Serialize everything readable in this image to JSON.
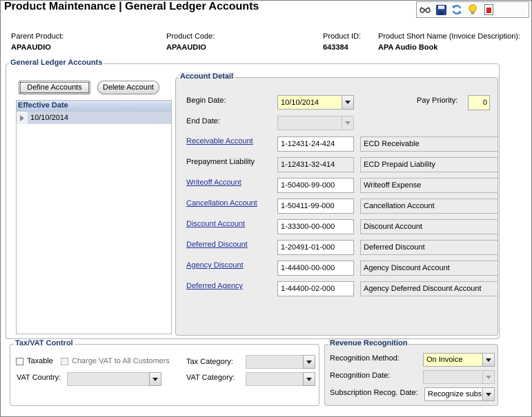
{
  "window": {
    "title": "Product Maintenance  |  General Ledger Accounts"
  },
  "toolbar": {
    "icons": [
      "glasses-icon",
      "save-icon",
      "refresh-icon",
      "lightbulb-icon",
      "report-icon"
    ]
  },
  "header": {
    "parent_product_label": "Parent Product:",
    "parent_product_value": "APAAUDIO",
    "product_code_label": "Product Code:",
    "product_code_value": "APAAUDIO",
    "product_id_label": "Product ID:",
    "product_id_value": "643384",
    "short_name_label": "Product Short Name (Invoice Description):",
    "short_name_value": "APA Audio Book"
  },
  "gl_accounts": {
    "legend": "General Ledger Accounts",
    "define_accounts_label": "Define Accounts",
    "delete_account_label": "Delete Account",
    "grid_header": "Effective Date",
    "rows": [
      "10/10/2014"
    ]
  },
  "account_detail": {
    "legend": "Account Detail",
    "begin_date_label": "Begin Date:",
    "begin_date_value": "10/10/2014",
    "end_date_label": "End Date:",
    "end_date_value": "",
    "pay_priority_label": "Pay Priority:",
    "pay_priority_value": "0",
    "accounts": [
      {
        "label": "Receivable Account",
        "link": true,
        "code": "1-12431-24-424",
        "description": "ECD Receivable",
        "code_readonly": false
      },
      {
        "label": "Prepayment Liability",
        "link": false,
        "code": "1-12431-32-414",
        "description": "ECD Prepaid Liability",
        "code_readonly": true
      },
      {
        "label": "Writeoff Account",
        "link": true,
        "code": "1-50400-99-000",
        "description": "Writeoff Expense",
        "code_readonly": false
      },
      {
        "label": "Cancellation Account",
        "link": true,
        "code": "1-50411-99-000",
        "description": "Cancellation Account",
        "code_readonly": false
      },
      {
        "label": "Discount Account",
        "link": true,
        "code": "1-33300-00-000",
        "description": "Discount Account",
        "code_readonly": false
      },
      {
        "label": "Deferred Discount",
        "link": true,
        "code": "1-20491-01-000",
        "description": "Deferred Discount",
        "code_readonly": false
      },
      {
        "label": "Agency Discount",
        "link": true,
        "code": "1-44400-00-000",
        "description": "Agency Discount Account",
        "code_readonly": false
      },
      {
        "label": "Deferred Agency",
        "link": true,
        "code": "1-44400-02-000",
        "description": "Agency Deferred Discount Account",
        "code_readonly": false
      }
    ]
  },
  "tax_vat": {
    "legend": "Tax/VAT Control",
    "taxable_label": "Taxable",
    "charge_vat_label": "Charge VAT to All Customers",
    "tax_category_label": "Tax Category:",
    "tax_category_value": "",
    "vat_country_label": "VAT Country:",
    "vat_country_value": "",
    "vat_category_label": "VAT Category:",
    "vat_category_value": ""
  },
  "revenue": {
    "legend": "Revenue Recognition",
    "method_label": "Recognition Method:",
    "method_value": "On Invoice",
    "date_label": "Recognition Date:",
    "date_value": "",
    "subscription_label": "Subscription Recog. Date:",
    "subscription_value": "Recognize subs"
  },
  "colors": {
    "accent": "#1f3a6b",
    "link": "#1f2f9a",
    "required_field": "#ffffc8",
    "grid_selected": "#cfd6e4"
  }
}
